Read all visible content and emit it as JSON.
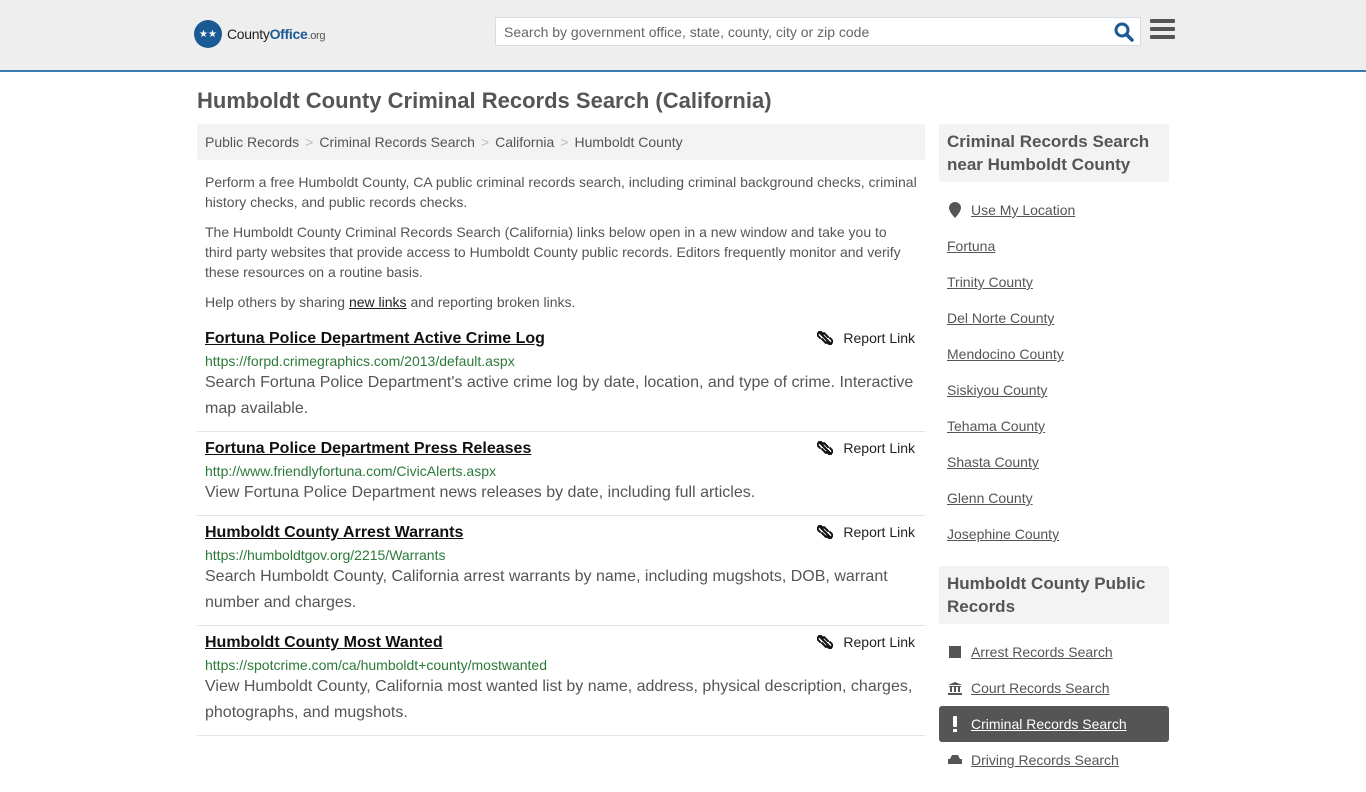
{
  "header": {
    "logo": {
      "county": "County",
      "office": "Office",
      "org": ".org"
    },
    "search_placeholder": "Search by government office, state, county, city or zip code"
  },
  "page_title": "Humboldt County Criminal Records Search (California)",
  "breadcrumb": [
    "Public Records",
    "Criminal Records Search",
    "California",
    "Humboldt County"
  ],
  "intro": {
    "p1": "Perform a free Humboldt County, CA public criminal records search, including criminal background checks, criminal history checks, and public records checks.",
    "p2": "The Humboldt County Criminal Records Search (California) links below open in a new window and take you to third party websites that provide access to Humboldt County public records. Editors frequently monitor and verify these resources on a routine basis.",
    "p3_before": "Help others by sharing ",
    "p3_link": "new links",
    "p3_after": " and reporting broken links."
  },
  "report_label": "Report Link",
  "results": [
    {
      "title": "Fortuna Police Department Active Crime Log",
      "url": "https://forpd.crimegraphics.com/2013/default.aspx",
      "desc": "Search Fortuna Police Department's active crime log by date, location, and type of crime. Interactive map available."
    },
    {
      "title": "Fortuna Police Department Press Releases",
      "url": "http://www.friendlyfortuna.com/CivicAlerts.aspx",
      "desc": "View Fortuna Police Department news releases by date, including full articles."
    },
    {
      "title": "Humboldt County Arrest Warrants",
      "url": "https://humboldtgov.org/2215/Warrants",
      "desc": "Search Humboldt County, California arrest warrants by name, including mugshots, DOB, warrant number and charges."
    },
    {
      "title": "Humboldt County Most Wanted",
      "url": "https://spotcrime.com/ca/humboldt+county/mostwanted",
      "desc": "View Humboldt County, California most wanted list by name, address, physical description, charges, photographs, and mugshots."
    }
  ],
  "sidebar": {
    "nearby_heading": "Criminal Records Search near Humboldt County",
    "use_location": "Use My Location",
    "nearby": [
      "Fortuna",
      "Trinity County",
      "Del Norte County",
      "Mendocino County",
      "Siskiyou County",
      "Tehama County",
      "Shasta County",
      "Glenn County",
      "Josephine County"
    ],
    "public_heading": "Humboldt County Public Records",
    "public": [
      {
        "label": "Arrest Records Search",
        "icon": "square-icon"
      },
      {
        "label": "Court Records Search",
        "icon": "courthouse-icon"
      },
      {
        "label": "Criminal Records Search",
        "icon": "exclamation-icon",
        "active": true
      },
      {
        "label": "Driving Records Search",
        "icon": "car-icon"
      }
    ]
  }
}
